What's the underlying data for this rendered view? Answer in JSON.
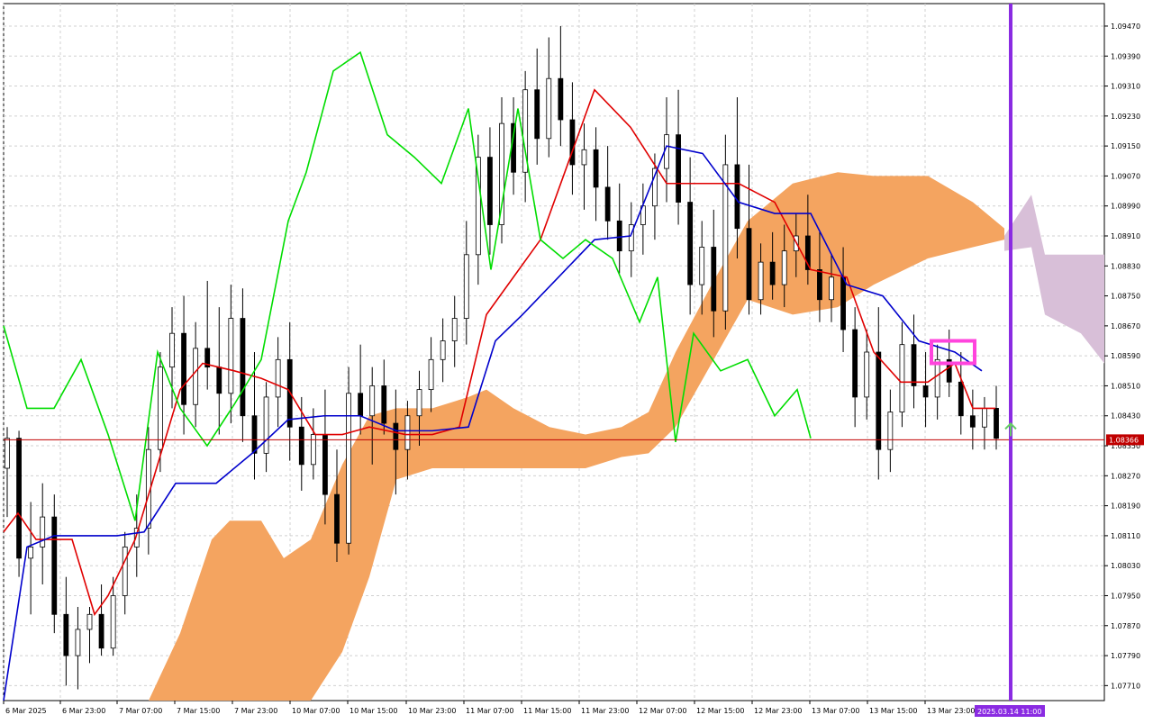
{
  "chart_data": {
    "type": "candlestick",
    "y_axis": {
      "ticks": [
        "1.09470",
        "1.09390",
        "1.09310",
        "1.09230",
        "1.09150",
        "1.09070",
        "1.08990",
        "1.08910",
        "1.08830",
        "1.08750",
        "1.08670",
        "1.08590",
        "1.08510",
        "1.08430",
        "1.08350",
        "1.08270",
        "1.08190",
        "1.08110",
        "1.08030",
        "1.07950",
        "1.07870",
        "1.07790",
        "1.07710"
      ],
      "range": [
        1.0767,
        1.0953
      ]
    },
    "x_axis": {
      "labels": [
        "6 Mar 2025",
        "6 Mar 23:00",
        "7 Mar 07:00",
        "7 Mar 15:00",
        "7 Mar 23:00",
        "10 Mar 07:00",
        "10 Mar 15:00",
        "10 Mar 23:00",
        "11 Mar 07:00",
        "11 Mar 15:00",
        "11 Mar 23:00",
        "12 Mar 07:00",
        "12 Mar 15:00",
        "12 Mar 23:00",
        "13 Mar 07:00",
        "13 Mar 15:00",
        "13 Mar 23:00"
      ],
      "current_time_label": "2025.03.14 11:00"
    },
    "current_price": "1.08366",
    "colors": {
      "bull_candle": "#1f5f99",
      "bear_candle": "#000000",
      "cloud_bullish": "#f4a460",
      "cloud_bearish": "#d8bfd8",
      "tenkan": "#e00000",
      "kijun": "#0000cc",
      "chikou": "#00dd00",
      "current_price_line": "#c00000",
      "current_time_line": "#8a2be2",
      "highlight_box": "#ff44dd",
      "signal_arrow": "#66cc66",
      "grid": "#d0d0d0"
    },
    "candles": {
      "note_fields": [
        "open",
        "high",
        "low",
        "close"
      ],
      "values": [
        [
          1.0829,
          1.084,
          1.0816,
          1.0837
        ],
        [
          1.0837,
          1.0839,
          1.08,
          1.0805
        ],
        [
          1.0805,
          1.082,
          1.079,
          1.0808
        ],
        [
          1.0808,
          1.0825,
          1.0798,
          1.0816
        ],
        [
          1.0816,
          1.0822,
          1.0785,
          1.079
        ],
        [
          1.079,
          1.08,
          1.0771,
          1.0779
        ],
        [
          1.0779,
          1.0792,
          1.077,
          1.0786
        ],
        [
          1.0786,
          1.0792,
          1.0777,
          1.079
        ],
        [
          1.079,
          1.0798,
          1.0779,
          1.0781
        ],
        [
          1.0781,
          1.08,
          1.0779,
          1.0795
        ],
        [
          1.0795,
          1.0812,
          1.079,
          1.0808
        ],
        [
          1.0808,
          1.0822,
          1.08,
          1.0813
        ],
        [
          1.0813,
          1.084,
          1.0806,
          1.0834
        ],
        [
          1.0834,
          1.086,
          1.0828,
          1.0856
        ],
        [
          1.0856,
          1.0872,
          1.0845,
          1.0865
        ],
        [
          1.0865,
          1.0875,
          1.0838,
          1.0846
        ],
        [
          1.0846,
          1.0868,
          1.084,
          1.0861
        ],
        [
          1.0861,
          1.0879,
          1.085,
          1.0856
        ],
        [
          1.0856,
          1.0872,
          1.0838,
          1.0849
        ],
        [
          1.0849,
          1.0878,
          1.0841,
          1.0869
        ],
        [
          1.0869,
          1.0877,
          1.0836,
          1.0843
        ],
        [
          1.0843,
          1.086,
          1.0826,
          1.0833
        ],
        [
          1.0833,
          1.0852,
          1.0828,
          1.0848
        ],
        [
          1.0848,
          1.0864,
          1.084,
          1.0858
        ],
        [
          1.0858,
          1.0868,
          1.0831,
          1.084
        ],
        [
          1.084,
          1.0848,
          1.0823,
          1.083
        ],
        [
          1.083,
          1.0845,
          1.0826,
          1.0838
        ],
        [
          1.0838,
          1.085,
          1.0814,
          1.0822
        ],
        [
          1.0822,
          1.0834,
          1.0804,
          1.0809
        ],
        [
          1.0809,
          1.0856,
          1.0806,
          1.0849
        ],
        [
          1.0849,
          1.0862,
          1.0838,
          1.0843
        ],
        [
          1.0843,
          1.0856,
          1.083,
          1.0851
        ],
        [
          1.0851,
          1.0858,
          1.0838,
          1.0841
        ],
        [
          1.0841,
          1.085,
          1.0822,
          1.0834
        ],
        [
          1.0834,
          1.0847,
          1.0826,
          1.0843
        ],
        [
          1.0843,
          1.0855,
          1.0835,
          1.085
        ],
        [
          1.085,
          1.0864,
          1.0844,
          1.0858
        ],
        [
          1.0858,
          1.0869,
          1.0852,
          1.0863
        ],
        [
          1.0863,
          1.0875,
          1.0856,
          1.0869
        ],
        [
          1.0869,
          1.0895,
          1.0862,
          1.0886
        ],
        [
          1.0886,
          1.0918,
          1.0878,
          1.0912
        ],
        [
          1.0912,
          1.092,
          1.0886,
          1.0894
        ],
        [
          1.0894,
          1.0928,
          1.0889,
          1.0921
        ],
        [
          1.0921,
          1.0928,
          1.0902,
          1.0908
        ],
        [
          1.0908,
          1.0935,
          1.09,
          1.093
        ],
        [
          1.093,
          1.0941,
          1.091,
          1.0917
        ],
        [
          1.0917,
          1.0944,
          1.0912,
          1.0933
        ],
        [
          1.0933,
          1.0947,
          1.0915,
          1.0922
        ],
        [
          1.0922,
          1.0932,
          1.0902,
          1.091
        ],
        [
          1.091,
          1.0921,
          1.0898,
          1.0914
        ],
        [
          1.0914,
          1.092,
          1.0895,
          1.0904
        ],
        [
          1.0904,
          1.0915,
          1.089,
          1.0895
        ],
        [
          1.0895,
          1.0905,
          1.0881,
          1.0887
        ],
        [
          1.0887,
          1.09,
          1.088,
          1.0894
        ],
        [
          1.0894,
          1.0905,
          1.0886,
          1.0899
        ],
        [
          1.0899,
          1.0913,
          1.089,
          1.0909
        ],
        [
          1.0909,
          1.0928,
          1.09,
          1.0918
        ],
        [
          1.0918,
          1.093,
          1.0894,
          1.09
        ],
        [
          1.09,
          1.0912,
          1.087,
          1.0878
        ],
        [
          1.0878,
          1.0895,
          1.087,
          1.0888
        ],
        [
          1.0888,
          1.0898,
          1.0864,
          1.0871
        ],
        [
          1.0871,
          1.0918,
          1.0866,
          1.091
        ],
        [
          1.091,
          1.0928,
          1.0885,
          1.0893
        ],
        [
          1.0893,
          1.091,
          1.087,
          1.0874
        ],
        [
          1.0874,
          1.0889,
          1.087,
          1.0884
        ],
        [
          1.0884,
          1.0892,
          1.0874,
          1.0878
        ],
        [
          1.0878,
          1.0894,
          1.0872,
          1.0887
        ],
        [
          1.0887,
          1.0897,
          1.088,
          1.0891
        ],
        [
          1.0891,
          1.0902,
          1.0878,
          1.0882
        ],
        [
          1.0882,
          1.0892,
          1.0868,
          1.0874
        ],
        [
          1.0874,
          1.0886,
          1.0868,
          1.088
        ],
        [
          1.088,
          1.0888,
          1.086,
          1.0866
        ],
        [
          1.0866,
          1.0872,
          1.084,
          1.0848
        ],
        [
          1.0848,
          1.0866,
          1.0842,
          1.086
        ],
        [
          1.086,
          1.0872,
          1.0826,
          1.0834
        ],
        [
          1.0834,
          1.085,
          1.0828,
          1.0844
        ],
        [
          1.0844,
          1.0868,
          1.084,
          1.0862
        ],
        [
          1.0862,
          1.087,
          1.0845,
          1.0851
        ],
        [
          1.0851,
          1.086,
          1.084,
          1.0848
        ],
        [
          1.0848,
          1.0862,
          1.0842,
          1.0858
        ],
        [
          1.0858,
          1.0866,
          1.0848,
          1.0852
        ],
        [
          1.0852,
          1.086,
          1.0838,
          1.0843
        ],
        [
          1.0843,
          1.085,
          1.0834,
          1.084
        ],
        [
          1.084,
          1.0848,
          1.0834,
          1.0845
        ],
        [
          1.0845,
          1.0851,
          1.0834,
          1.0837
        ]
      ]
    },
    "highlight": "Tenkan/Kijun region near 13 Mar 23:00",
    "signal": "up arrow near current bar"
  }
}
